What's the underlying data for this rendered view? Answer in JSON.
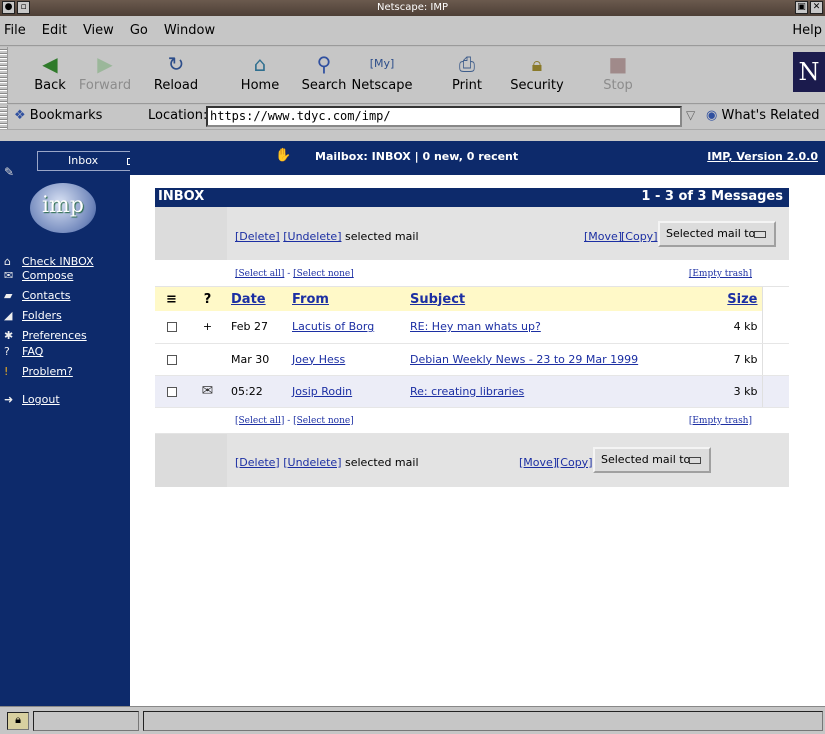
{
  "window": {
    "title": "Netscape: IMP"
  },
  "menu": {
    "items": [
      "File",
      "Edit",
      "View",
      "Go",
      "Window"
    ],
    "help": "Help"
  },
  "toolbar": {
    "buttons": [
      {
        "label": "Back",
        "icon": "back-arrow-icon",
        "enabled": true
      },
      {
        "label": "Forward",
        "icon": "forward-arrow-icon",
        "enabled": false
      },
      {
        "label": "Reload",
        "icon": "reload-icon",
        "enabled": true
      },
      {
        "label": "Home",
        "icon": "home-icon",
        "enabled": true
      },
      {
        "label": "Search",
        "icon": "search-icon",
        "enabled": true
      },
      {
        "label": "Netscape",
        "icon": "netscape-icon",
        "enabled": true
      },
      {
        "label": "Print",
        "icon": "print-icon",
        "enabled": true
      },
      {
        "label": "Security",
        "icon": "security-lock-icon",
        "enabled": true
      },
      {
        "label": "Stop",
        "icon": "stop-icon",
        "enabled": false
      }
    ],
    "logo": "N"
  },
  "location": {
    "bookmarks": "Bookmarks",
    "label": "Location:",
    "url": "https://www.tdyc.com/imp/",
    "related": "What's Related"
  },
  "sidebar": {
    "folder_select": "Inbox",
    "logo_text": "imp",
    "nav": [
      {
        "label": "Check INBOX",
        "icon": "home-icon"
      },
      {
        "label": "Compose",
        "icon": "compose-icon"
      },
      {
        "label": "Contacts",
        "icon": "contacts-icon"
      },
      {
        "label": "Folders",
        "icon": "folders-icon"
      },
      {
        "label": "Preferences",
        "icon": "preferences-icon"
      },
      {
        "label": "FAQ",
        "icon": "question-icon"
      },
      {
        "label": "Problem?",
        "icon": "exclamation-icon"
      }
    ],
    "logout": "Logout"
  },
  "header": {
    "mailbox_status": "Mailbox: INBOX  |  0 new, 0 recent",
    "version": "IMP, Version 2.0.0"
  },
  "mailbox": {
    "title": "INBOX",
    "range": "1 - 3 of 3 Messages",
    "delete": "[Delete]",
    "undelete": "[Undelete]",
    "selected_text": " selected mail",
    "move": "[Move]",
    "copy": "[Copy]",
    "selected_mail_to": "Selected mail to:",
    "select_all": "[Select all]",
    "dash": " - ",
    "select_none": "[Select none]",
    "empty_trash": "[Empty trash]",
    "columns": {
      "flag": "?",
      "date": "Date",
      "from": "From",
      "subject": "Subject",
      "size": "Size"
    },
    "messages": [
      {
        "flag": "+",
        "date": "Feb 27",
        "from": "Lacutis of Borg",
        "subject": "RE: Hey man whats up?",
        "size": "4 kb"
      },
      {
        "flag": "",
        "date": "Mar 30",
        "from": "Joey Hess",
        "subject": "Debian Weekly News - 23 to 29 Mar 1999",
        "size": "7 kb"
      },
      {
        "flag": "envelope-icon",
        "date": "05:22",
        "from": "Josip Rodin",
        "subject": "Re: creating libraries",
        "size": "3 kb"
      }
    ]
  }
}
